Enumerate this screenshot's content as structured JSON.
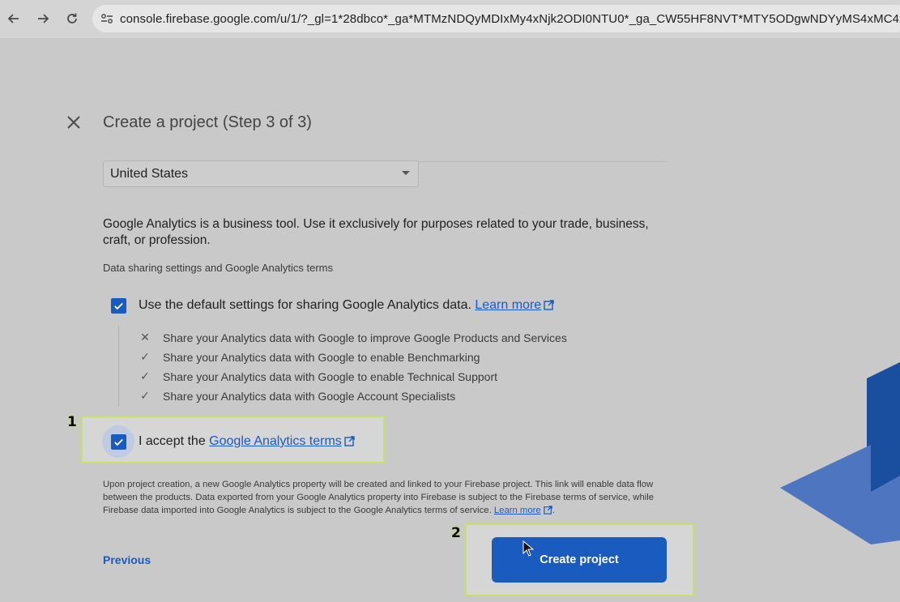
{
  "browser": {
    "url": "console.firebase.google.com/u/1/?_gl=1*28dbco*_ga*MTMzNDQyMDIxMy4xNjk2ODI0NTU0*_ga_CW55HF8NVT*MTY5ODgwNDYyMS4xMC4xLjE"
  },
  "dialog": {
    "title": "Create a project (Step 3 of 3)",
    "country_select": {
      "value": "United States"
    },
    "description": "Google Analytics is a business tool. Use it exclusively for purposes related to your trade, business, craft, or profession.",
    "section_label": "Data sharing settings and Google Analytics terms",
    "default_settings": {
      "label": "Use the default settings for sharing Google Analytics data.",
      "link": "Learn more",
      "checked": true
    },
    "share_items": [
      {
        "mark": "✕",
        "text": "Share your Analytics data with Google to improve Google Products and Services"
      },
      {
        "mark": "✓",
        "text": "Share your Analytics data with Google to enable Benchmarking"
      },
      {
        "mark": "✓",
        "text": "Share your Analytics data with Google to enable Technical Support"
      },
      {
        "mark": "✓",
        "text": "Share your Analytics data with Google Account Specialists"
      }
    ],
    "accept_terms": {
      "prefix": "I accept the",
      "link": "Google Analytics terms",
      "checked": true
    },
    "notice": "Upon project creation, a new Google Analytics property will be created and linked to your Firebase project. This link will enable data flow between the products. Data exported from your Google Analytics property into Firebase is subject to the Firebase terms of service, while Firebase data imported into Google Analytics is subject to the Google Analytics terms of service.",
    "notice_link": "Learn more",
    "notice_end": ".",
    "previous_label": "Previous",
    "create_label": "Create project"
  },
  "annotations": {
    "step1": "1",
    "step2": "2",
    "highlight_color": "#c6e06a"
  },
  "colors": {
    "accent": "#1a5bbf"
  }
}
